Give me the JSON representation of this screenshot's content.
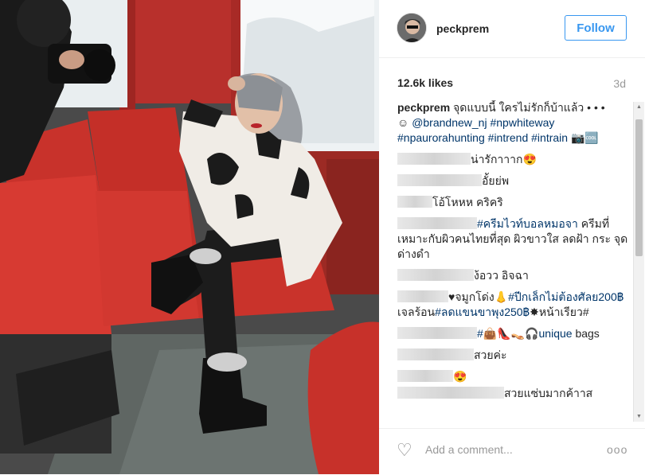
{
  "post": {
    "username": "peckprem",
    "follow_label": "Follow",
    "likes": "12.6k likes",
    "age": "3d"
  },
  "caption": {
    "user": "peckprem",
    "text": "จุดแบบนี้ ใครไม่รักก็บ้าแล้ว • • •",
    "line2_emoji": "☺",
    "mention": "@brandnew_nj",
    "tag1": "#npwhiteway",
    "tag2": "#npaurorahunting",
    "tag3": "#intrend",
    "tag4": "#intrain",
    "trailing": "📷🆒"
  },
  "comments": [
    {
      "text": "น่ารักาาาก😍"
    },
    {
      "text": "อั้ยย่พ"
    },
    {
      "text": "โอ้โหหห คริคริ"
    },
    {
      "tag": "#ครีมไวท์บอลหมอจา",
      "text": " ครีมที่เหมาะกับผิวคนไทยที่สุด ผิวขาวใส ลดฝ้า กระ จุดด่างดำ"
    },
    {
      "text": "ง้อวว อิจฉา"
    },
    {
      "pre": "♥จมูกโด่ง👃",
      "tag": "#ปีกเล็กไม่ต้องศัลย200฿",
      "mid": " เจลร้อน",
      "tag2": "#ลดแขนขาพุง250฿",
      "post": "✸หน้าเรียว#"
    },
    {
      "tag": "#👜👠👡🎧unique",
      "text": " bags"
    },
    {
      "text": "สวยค่ะ"
    },
    {
      "text": "😍"
    },
    {
      "text": "สวยแซ่บมากค้าาส"
    }
  ],
  "footer": {
    "placeholder": "Add a comment...",
    "more": "ooo"
  },
  "icons": {
    "heart": "heart-outline-icon",
    "more": "more-options-icon"
  },
  "colors": {
    "link": "#003569",
    "follow": "#3897f0"
  }
}
